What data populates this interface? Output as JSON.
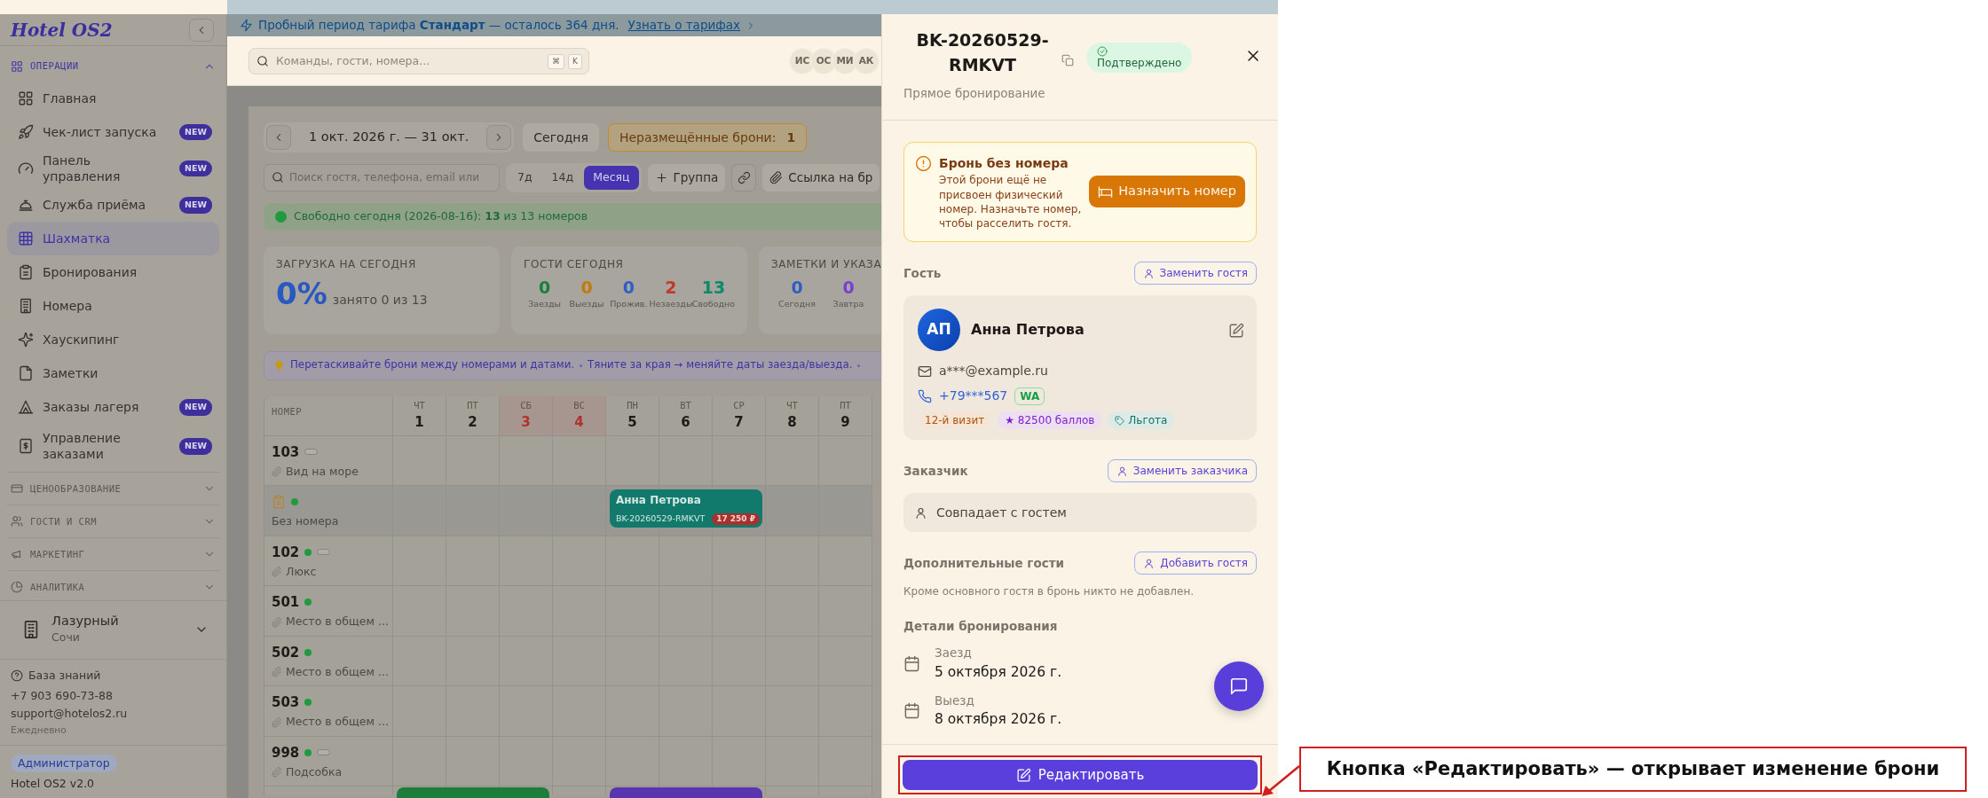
{
  "sidebar": {
    "logo": "Hotel OS2",
    "sections": [
      {
        "title": "ОПЕРАЦИИ",
        "expanded": true,
        "items": [
          {
            "label": "Главная",
            "selected": false
          },
          {
            "label": "Чек-лист запуска",
            "badge": "NEW",
            "selected": false
          },
          {
            "label": "Панель управления",
            "badge": "NEW",
            "selected": false
          },
          {
            "label": "Служба приёма",
            "badge": "NEW",
            "selected": false
          },
          {
            "label": "Шахматка",
            "selected": true
          },
          {
            "label": "Бронирования",
            "selected": false
          },
          {
            "label": "Номера",
            "selected": false
          },
          {
            "label": "Хаускипинг",
            "selected": false
          },
          {
            "label": "Заметки",
            "selected": false
          },
          {
            "label": "Заказы лагеря",
            "badge": "NEW",
            "selected": false
          },
          {
            "label": "Управление заказами",
            "badge": "NEW",
            "selected": false
          }
        ]
      },
      {
        "title": "ЦЕНООБРАЗОВАНИЕ",
        "expanded": false
      },
      {
        "title": "ГОСТИ И CRM",
        "expanded": false
      },
      {
        "title": "МАРКЕТИНГ",
        "expanded": false
      },
      {
        "title": "АНАЛИТИКА",
        "expanded": false
      }
    ],
    "property": {
      "name": "Лазурный",
      "city": "Сочи"
    },
    "help": {
      "link": "База знаний",
      "phone": "+7 903 690-73-88",
      "email": "support@hotelos2.ru",
      "hours": "Ежедневно"
    },
    "role": "Администратор",
    "version": "Hotel OS2 v2.0"
  },
  "banner": {
    "text": "Пробный период тарифа **Стандарт** — осталось 364 дня.",
    "link": "Узнать о тарифах"
  },
  "header": {
    "search_placeholder": "Команды, гости, номера...",
    "shortcut": [
      "⌘",
      "K"
    ],
    "avatars": [
      "ИС",
      "ОС",
      "МИ",
      "АК"
    ]
  },
  "toolbar": {
    "range": "1 окт. 2026 г. — 31 окт.",
    "today": "Сегодня",
    "unassigned_label": "Неразмещённые брони:",
    "unassigned_count": "1",
    "search_placeholder": "Поиск гостя, телефона, email или",
    "views": [
      {
        "label": "7д",
        "selected": false
      },
      {
        "label": "14д",
        "selected": false
      },
      {
        "label": "Месяц",
        "selected": true
      }
    ],
    "group": "Группа",
    "share_link": "Ссылка на бр"
  },
  "availability": "Свободно сегодня (2026-08-16): **13** из 13 номеров",
  "stats": [
    {
      "kind": "percent",
      "title": "ЗАГРУЗКА НА СЕГОДНЯ",
      "value": "0%",
      "caption": "занято 0 из 13"
    },
    {
      "kind": "counts",
      "title": "ГОСТИ СЕГОДНЯ",
      "items": [
        {
          "value": "0",
          "label": "Заезды",
          "color": "#16803c"
        },
        {
          "value": "0",
          "label": "Выезды",
          "color": "#c27a0e"
        },
        {
          "value": "0",
          "label": "Прожив.",
          "color": "#2f5fc4"
        },
        {
          "value": "2",
          "label": "Незаезды",
          "color": "#c23a2c"
        },
        {
          "value": "13",
          "label": "Свободно",
          "color": "#0d8a6a"
        }
      ]
    },
    {
      "kind": "counts",
      "title": "ЗАМЕТКИ И УКАЗА",
      "items": [
        {
          "value": "0",
          "label": "Сегодня",
          "color": "#2f5fc4"
        },
        {
          "value": "0",
          "label": "Завтра",
          "color": "#7a3fd0"
        }
      ]
    }
  ],
  "hints": [
    "Перетаскивайте брони между номерами и датами.",
    "Тяните за края → меняйте даты заезда/выезда."
  ],
  "grid": {
    "column_header": "НОМЕР",
    "days": [
      {
        "weekday": "ЧТ",
        "day": "1",
        "weekend": false
      },
      {
        "weekday": "ПТ",
        "day": "2",
        "weekend": false
      },
      {
        "weekday": "СБ",
        "day": "3",
        "weekend": true
      },
      {
        "weekday": "ВС",
        "day": "4",
        "weekend": true
      },
      {
        "weekday": "ПН",
        "day": "5",
        "weekend": false
      },
      {
        "weekday": "ВТ",
        "day": "6",
        "weekend": false
      },
      {
        "weekday": "СР",
        "day": "7",
        "weekend": false
      },
      {
        "weekday": "ЧТ",
        "day": "8",
        "weekend": false
      },
      {
        "weekday": "ПТ",
        "day": "9",
        "weekend": false
      }
    ],
    "rows": [
      {
        "kind": "room",
        "number": "103",
        "status_dot": false,
        "capsule": true,
        "type": "Вид на море"
      },
      {
        "kind": "unassigned",
        "label": "Без номера",
        "status_dot": true,
        "cells": [
          {
            "kind": "empty"
          },
          {
            "kind": "empty"
          },
          {
            "kind": "empty"
          },
          {
            "kind": "empty"
          },
          {
            "kind": "booking_start",
            "booking": {
              "guest": "Анна Петрова",
              "code": "BK-20260529-RMKVT",
              "price": "17 250 ₽",
              "color": "#127a6c"
            }
          },
          {
            "kind": "booking_continues"
          },
          {
            "kind": "booking_continues"
          },
          {
            "kind": "empty"
          },
          {
            "kind": "empty"
          }
        ]
      },
      {
        "kind": "room",
        "number": "102",
        "status_dot": true,
        "capsule": true,
        "type": "Люкс"
      },
      {
        "kind": "room",
        "number": "501",
        "status_dot": true,
        "capsule": false,
        "type": "Место в общем …"
      },
      {
        "kind": "room",
        "number": "502",
        "status_dot": true,
        "capsule": false,
        "type": "Место в общем …"
      },
      {
        "kind": "room",
        "number": "503",
        "status_dot": true,
        "capsule": false,
        "type": "Место в общем …"
      },
      {
        "kind": "room",
        "number": "998",
        "status_dot": true,
        "capsule": true,
        "type": "Подсобка"
      },
      {
        "kind": "partial",
        "cells": [
          {
            "kind": "booking_start",
            "booking": {
              "color": "#1c7d3c"
            }
          },
          {
            "kind": "booking_continues"
          },
          {
            "kind": "booking_continues"
          },
          {
            "kind": "empty"
          },
          {
            "kind": "booking_start",
            "booking": {
              "color": "#5a35b0"
            }
          },
          {
            "kind": "booking_continues"
          },
          {
            "kind": "booking_continues"
          },
          {
            "kind": "empty"
          },
          {
            "kind": "empty"
          }
        ]
      }
    ]
  },
  "drawer": {
    "code": "BK-20260529-RMKVT",
    "status": "Подтверждено",
    "source": "Прямое бронирование",
    "alert": {
      "title": "Бронь без номера",
      "text": "Этой брони ещё не присвоен физический номер. Назначьте номер, чтобы расселить гостя.",
      "action": "Назначить номер"
    },
    "guest": {
      "heading": "Гость",
      "action": "Заменить гостя",
      "initials": "АП",
      "name": "Анна Петрова",
      "email": "a***@example.ru",
      "phone": "+79***567",
      "messenger": "WA",
      "tags": [
        {
          "kind": "plain",
          "text": "12-й визит",
          "color": "#b45309"
        },
        {
          "kind": "plain",
          "text": "★ 82500 баллов",
          "color": "#7e22ce"
        },
        {
          "kind": "tagged",
          "text": "Льгота",
          "color": "#0f766e"
        }
      ]
    },
    "customer": {
      "heading": "Заказчик",
      "action": "Заменить заказчика",
      "value": "Совпадает с гостем"
    },
    "extra_guests": {
      "heading": "Дополнительные гости",
      "action": "Добавить гостя",
      "note": "Кроме основного гостя в бронь никто не добавлен."
    },
    "details": {
      "heading": "Детали бронирования",
      "items": [
        {
          "label": "Заезд",
          "value": "5 октября 2026 г."
        },
        {
          "label": "Выезд",
          "value": "8 октября 2026 г."
        }
      ]
    },
    "edit": "Редактировать"
  },
  "annotation": "Кнопка «Редактировать» — открывает изменение брони"
}
